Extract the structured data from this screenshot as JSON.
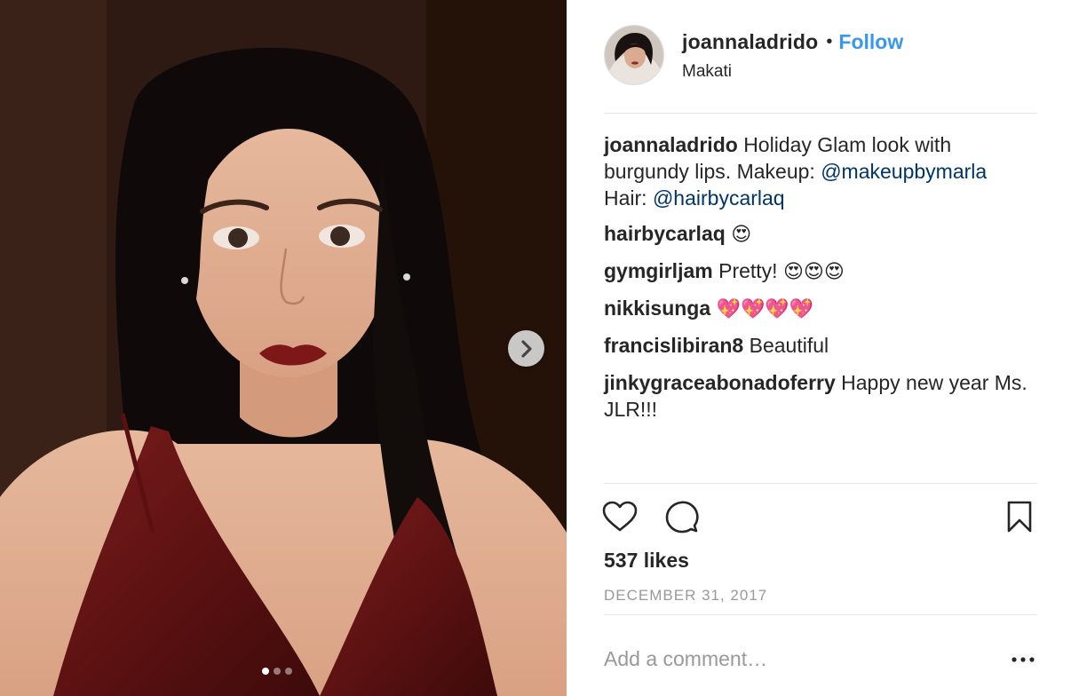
{
  "post": {
    "username": "joannaladrido",
    "separator": "•",
    "follow_label": "Follow",
    "location": "Makati"
  },
  "caption": {
    "username": "joannaladrido",
    "text": "Holiday Glam look with burgundy lips. Makeup: ",
    "mention_makeup": "@makeupbymarla",
    "hair_prefix": "Hair: ",
    "mention_hair": "@hairbycarlaq"
  },
  "comments": [
    {
      "user": "hairbycarlaq",
      "text": "",
      "emoji": "😍"
    },
    {
      "user": "gymgirljam",
      "text": "Pretty! ",
      "emoji": "😍😍😍"
    },
    {
      "user": "nikkisunga",
      "text": "",
      "emoji": "💖💖💖💖"
    },
    {
      "user": "francislibiran8",
      "text": "Beautiful",
      "emoji": ""
    },
    {
      "user": "jinkygraceabonadoferry",
      "text": "Happy new year Ms. JLR!!!",
      "emoji": ""
    }
  ],
  "icons": {
    "like": "heart-icon",
    "comment": "speech-bubble-icon",
    "save": "bookmark-icon",
    "next": "chevron-right-icon",
    "more": "more-options-icon"
  },
  "likes_text": "537 likes",
  "date_text": "DECEMBER 31, 2017",
  "comment_box": {
    "placeholder": "Add a comment…"
  },
  "carousel": {
    "count": 3,
    "active": 1
  },
  "colors": {
    "accent": "#3897f0",
    "mention": "#003569",
    "muted": "#999999",
    "text": "#262626"
  }
}
